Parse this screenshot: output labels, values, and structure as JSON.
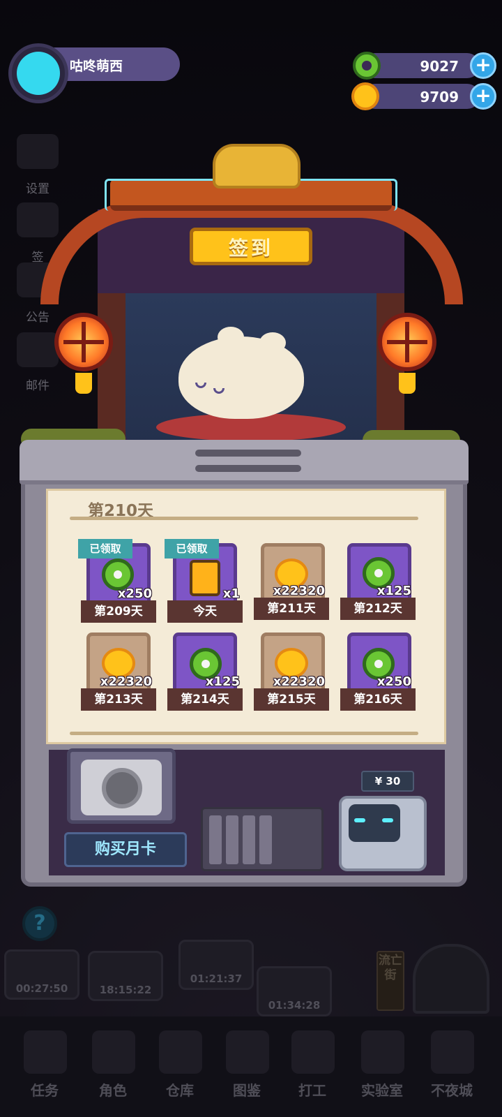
{
  "player": {
    "name": "咕咚萌西",
    "avatar": "cat-avatar-icon"
  },
  "currencies": [
    {
      "name": "green-gem-coin",
      "value": "9027",
      "color": "#6ac634"
    },
    {
      "name": "gold-coin",
      "value": "9709",
      "color": "#ffc21a"
    }
  ],
  "side_menu": [
    "设置",
    "签",
    "公告",
    "邮件"
  ],
  "shrine": {
    "sign": "签到"
  },
  "checkin": {
    "title": "第210天",
    "claimed_label": "已领取",
    "rewards": [
      {
        "day": "第209天",
        "qty": "x250",
        "item": "green-gem-coin",
        "bg": "purple",
        "claimed": true
      },
      {
        "day": "今天",
        "qty": "x1",
        "item": "battery",
        "bg": "purple",
        "claimed": true
      },
      {
        "day": "第211天",
        "qty": "x22320",
        "item": "gold-coin",
        "bg": "beige",
        "claimed": false
      },
      {
        "day": "第212天",
        "qty": "x125",
        "item": "green-gem-coin",
        "bg": "purple",
        "claimed": false
      },
      {
        "day": "第213天",
        "qty": "x22320",
        "item": "gold-coin",
        "bg": "beige",
        "claimed": false
      },
      {
        "day": "第214天",
        "qty": "x125",
        "item": "green-gem-coin",
        "bg": "purple",
        "claimed": false
      },
      {
        "day": "第215天",
        "qty": "x22320",
        "item": "gold-coin",
        "bg": "beige",
        "claimed": false
      },
      {
        "day": "第216天",
        "qty": "x250",
        "item": "green-gem-coin",
        "bg": "purple",
        "claimed": false
      }
    ]
  },
  "monthly_card": {
    "button": "购买月卡",
    "price": "¥ 30"
  },
  "timers": [
    "00:27:50",
    "18:15:22",
    "01:21:37",
    "01:34:28"
  ],
  "street_sign": "流亡街",
  "help_icon": "?",
  "nav": [
    "任务",
    "角色",
    "仓库",
    "图鉴",
    "打工",
    "实验室",
    "不夜城"
  ]
}
